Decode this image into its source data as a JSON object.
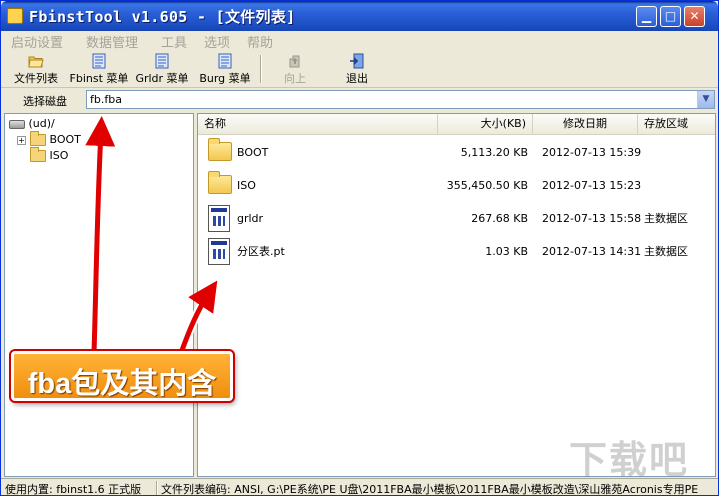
{
  "window": {
    "title": "FbinstTool v1.605 - [文件列表]",
    "controls": {
      "minimize": "▁",
      "maximize": "□",
      "close": "✕"
    }
  },
  "menubar": {
    "items": [
      {
        "label": "启动设置"
      },
      {
        "label": "数据管理"
      },
      {
        "label": "工具"
      },
      {
        "label": "选项"
      },
      {
        "label": "帮助"
      }
    ]
  },
  "toolbar": {
    "buttons": [
      {
        "label": "文件列表",
        "icon": "folder-open-icon",
        "enabled": true
      },
      {
        "label": "Fbinst 菜单",
        "icon": "menu-document-icon",
        "enabled": true
      },
      {
        "label": "Grldr 菜单",
        "icon": "menu-document-icon",
        "enabled": true
      },
      {
        "label": "Burg 菜单",
        "icon": "menu-document-icon",
        "enabled": true
      },
      {
        "label": "向上",
        "icon": "up-arrow-icon",
        "enabled": false
      },
      {
        "label": "退出",
        "icon": "exit-door-icon",
        "enabled": true
      }
    ]
  },
  "drive": {
    "label": "选择磁盘",
    "value": "fb.fba"
  },
  "tree": {
    "root": {
      "label": "(ud)/",
      "icon": "drive-icon"
    },
    "children": [
      {
        "label": "BOOT",
        "icon": "folder-icon",
        "expandable": true
      },
      {
        "label": "ISO",
        "icon": "folder-icon",
        "expandable": false
      }
    ]
  },
  "list": {
    "columns": [
      "名称",
      "大小(KB)",
      "修改日期",
      "存放区域"
    ],
    "rows": [
      {
        "name": "BOOT",
        "size": "5,113.20 KB",
        "date": "2012-07-13 15:39",
        "area": "",
        "icon": "folder-icon"
      },
      {
        "name": "ISO",
        "size": "355,450.50 KB",
        "date": "2012-07-13 15:23",
        "area": "",
        "icon": "folder-icon"
      },
      {
        "name": "grldr",
        "size": "267.68 KB",
        "date": "2012-07-13 15:58",
        "area": "主数据区",
        "icon": "file-icon"
      },
      {
        "name": "分区表.pt",
        "size": "1.03 KB",
        "date": "2012-07-13 14:31",
        "area": "主数据区",
        "icon": "file-icon"
      }
    ]
  },
  "annotation": {
    "text": "fba包及其内含",
    "color": "#f5a020",
    "arrow_color": "#e00000"
  },
  "statusbar": {
    "left": "使用内置: fbinst1.6 正式版",
    "right": "文件列表编码: ANSI, G:\\PE系统\\PE U盘\\2011FBA最小模板\\2011FBA最小模板改造\\深山雅苑Acronis专用PE"
  },
  "watermark": "下载吧"
}
